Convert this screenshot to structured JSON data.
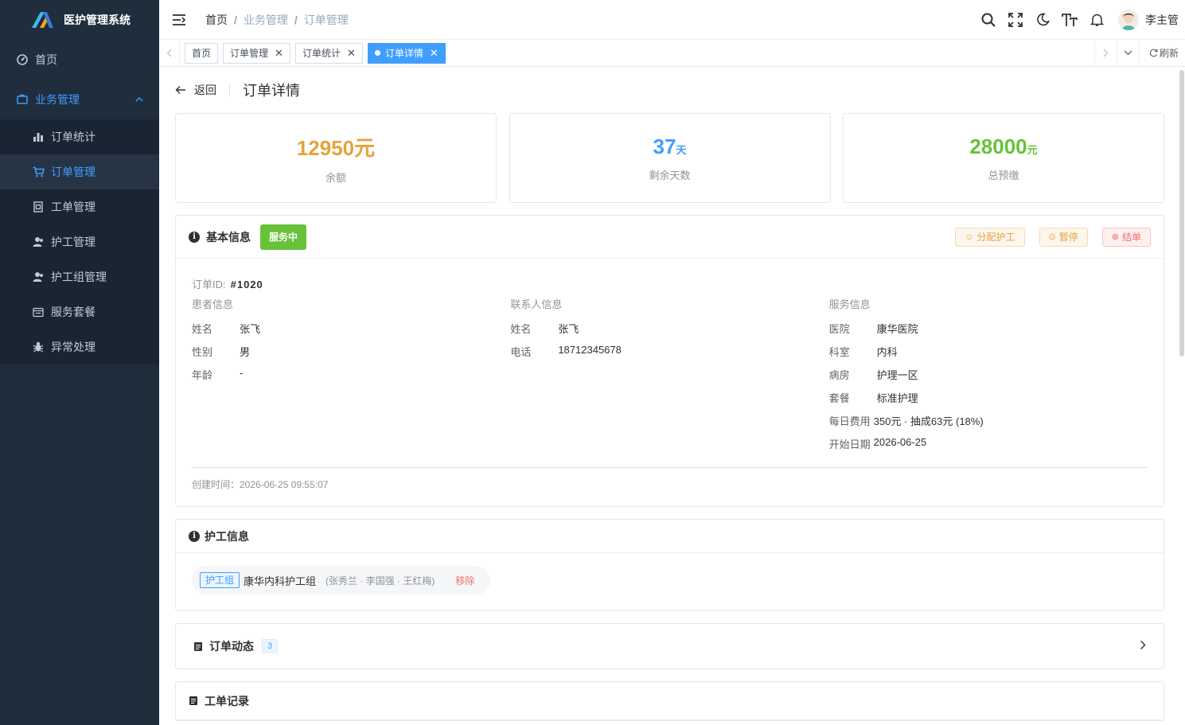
{
  "app": {
    "title": "医护管理系统"
  },
  "sidebar": {
    "home": "首页",
    "business": "业务管理",
    "items": [
      {
        "label": "订单统计",
        "icon": "bar-chart-icon"
      },
      {
        "label": "订单管理",
        "icon": "cart-icon"
      },
      {
        "label": "工单管理",
        "icon": "ticket-icon"
      },
      {
        "label": "护工管理",
        "icon": "user-icon"
      },
      {
        "label": "护工组管理",
        "icon": "group-icon"
      },
      {
        "label": "服务套餐",
        "icon": "package-icon"
      },
      {
        "label": "异常处理",
        "icon": "bug-icon"
      }
    ]
  },
  "navbar": {
    "breadcrumb": [
      "首页",
      "业务管理",
      "订单管理"
    ],
    "username": "李主管"
  },
  "tags": {
    "items": [
      "首页",
      "订单管理",
      "订单统计",
      "订单详情"
    ],
    "refresh": "刷新"
  },
  "page": {
    "back": "返回",
    "title": "订单详情"
  },
  "stats": [
    {
      "value": "12950",
      "unit": "元",
      "label": "余额",
      "color": "#e6a23c"
    },
    {
      "value": "37",
      "unit": "天",
      "label": "剩余天数",
      "color": "#409eff"
    },
    {
      "value": "28000",
      "unit": "元",
      "label": "总预缴",
      "color": "#67c23a"
    }
  ],
  "basic": {
    "title": "基本信息",
    "status": "服务中",
    "actions": {
      "assign": "分配护工",
      "pause": "暂停",
      "finish": "结单"
    },
    "order_id_label": "订单ID:",
    "order_id": "#1020",
    "patient": {
      "header": "患者信息",
      "name_k": "姓名",
      "name_v": "张飞",
      "gender_k": "性别",
      "gender_v": "男",
      "age_k": "年龄",
      "age_v": "-"
    },
    "contact": {
      "header": "联系人信息",
      "name_k": "姓名",
      "name_v": "张飞",
      "phone_k": "电话",
      "phone_v": "18712345678"
    },
    "service": {
      "header": "服务信息",
      "hospital_k": "医院",
      "hospital_v": "康华医院",
      "dept_k": "科室",
      "dept_v": "内科",
      "ward_k": "病房",
      "ward_v": "护理一区",
      "package_k": "套餐",
      "package_v": "标准护理",
      "daily_k": "每日费用",
      "daily_v": "350元 · 抽成63元 (18%)",
      "start_k": "开始日期",
      "start_v": "2026-06-25"
    },
    "created": "创建时间：2026-06-25 09:55:07"
  },
  "nurse": {
    "title": "护工信息",
    "tag": "护工组",
    "group": "康华内科护工组",
    "members": "(张秀兰 · 李国强 · 王红梅)",
    "remove": "移除"
  },
  "dynamics": {
    "title": "订单动态",
    "count": "3"
  },
  "records": {
    "title": "工单记录"
  }
}
